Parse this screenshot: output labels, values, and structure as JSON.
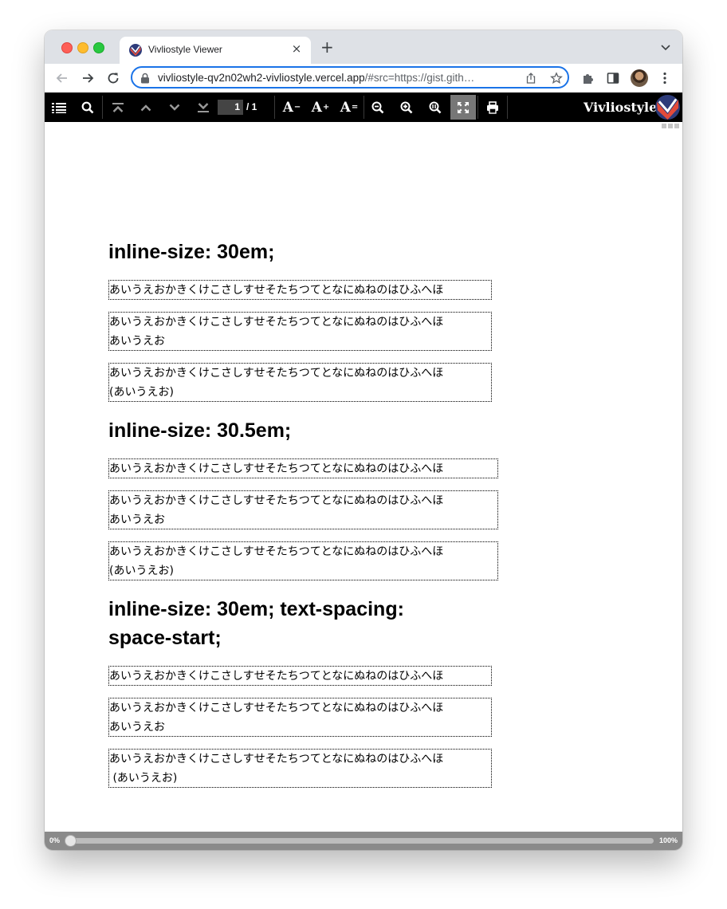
{
  "browser": {
    "tab": {
      "title": "Vivliostyle Viewer",
      "close_glyph": "×",
      "favicon": "vivliostyle-logo-icon"
    },
    "new_tab_glyph": "+",
    "address": {
      "host": "vivliostyle-qv2n02wh2-vivliostyle.vercel.app",
      "rest": "/#src=https://gist.gith…"
    }
  },
  "viewer_toolbar": {
    "page_current": "1",
    "page_total": "/ 1",
    "font_decrease_label": "A",
    "font_decrease_sup": "−",
    "font_increase_label": "A",
    "font_increase_sup": "+",
    "font_reset_label": "A",
    "font_reset_sup": "=",
    "brand": "Vivliostyle"
  },
  "document": {
    "sections": [
      {
        "heading": "inline-size: 30em;",
        "boxes": [
          "あいうえおかきくけこさしすせそたちつてとなにぬねのはひふへほ",
          "あいうえおかきくけこさしすせそたちつてとなにぬねのはひふへほ\nあいうえお",
          "あいうえおかきくけこさしすせそたちつてとなにぬねのはひふへほ\n(あいうえお)"
        ]
      },
      {
        "heading": "inline-size: 30.5em;",
        "boxes": [
          "あいうえおかきくけこさしすせそたちつてとなにぬねのはひふへほ",
          "あいうえおかきくけこさしすせそたちつてとなにぬねのはひふへほ\nあいうえお",
          "あいうえおかきくけこさしすせそたちつてとなにぬねのはひふへほ\n(あいうえお)"
        ]
      },
      {
        "heading_line1": "inline-size: 30em; text-spacing:",
        "heading_line2": "space-start;",
        "boxes": [
          "あいうえおかきくけこさしすせそたちつてとなにぬねのはひふへほ",
          "あいうえおかきくけこさしすせそたちつてとなにぬねのはひふへほ\nあいうえお",
          "あいうえおかきくけこさしすせそたちつてとなにぬねのはひふへほ\n (あいうえお)"
        ]
      }
    ]
  },
  "progress": {
    "start_label": "0%",
    "end_label": "100%",
    "value": 0
  }
}
